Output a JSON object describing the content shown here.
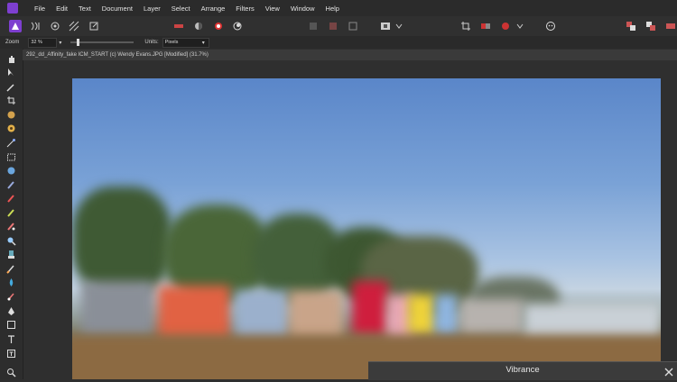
{
  "menu": {
    "items": [
      "File",
      "Edit",
      "Text",
      "Document",
      "Layer",
      "Select",
      "Arrange",
      "Filters",
      "View",
      "Window",
      "Help"
    ]
  },
  "context_toolbar": {
    "zoom_label": "Zoom",
    "zoom_value": "32 %",
    "units_label": "Units:",
    "units_value": "Pixels"
  },
  "document": {
    "tab_title": "292_dd_Affinity_fake ICM_START (c) Wendy Evans.JPG [Modified] (31.7%)"
  },
  "panel": {
    "title": "Vibrance"
  },
  "icons": {
    "app": "affinity-photo-icon",
    "close": "close-icon"
  },
  "colors": {
    "accent": "#7e3fd0",
    "background": "#2f2f2f"
  }
}
